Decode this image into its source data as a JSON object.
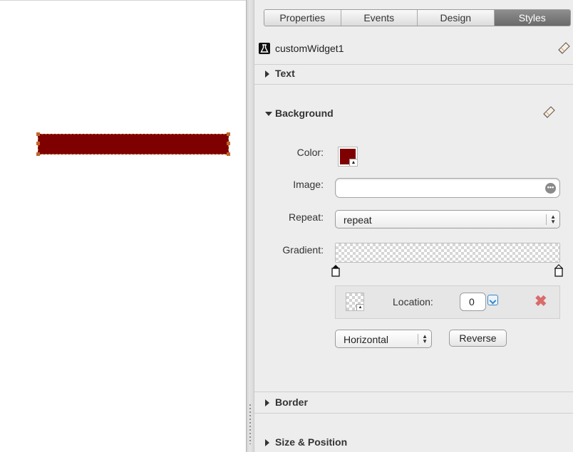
{
  "canvas": {
    "widget_color": "#7f0000"
  },
  "tabs": [
    {
      "label": "Properties",
      "active": false
    },
    {
      "label": "Events",
      "active": false
    },
    {
      "label": "Design",
      "active": false
    },
    {
      "label": "Styles",
      "active": true
    }
  ],
  "widget": {
    "name": "customWidget1",
    "icon": "flask-icon"
  },
  "sections": {
    "text": "Text",
    "background": "Background",
    "border": "Border",
    "size_position": "Size & Position"
  },
  "background": {
    "color_label": "Color:",
    "color_value": "#7f0000",
    "image_label": "Image:",
    "image_value": "",
    "repeat_label": "Repeat:",
    "repeat_value": "repeat",
    "gradient_label": "Gradient:",
    "location_label": "Location:",
    "location_value": "0",
    "direction_value": "Horizontal",
    "reverse_label": "Reverse"
  },
  "colors": {
    "active_tab": "#7a7a7a",
    "panel_bg": "#ededed",
    "remove_red": "#d96b6b",
    "dropdown_blue": "#3a87c7"
  }
}
